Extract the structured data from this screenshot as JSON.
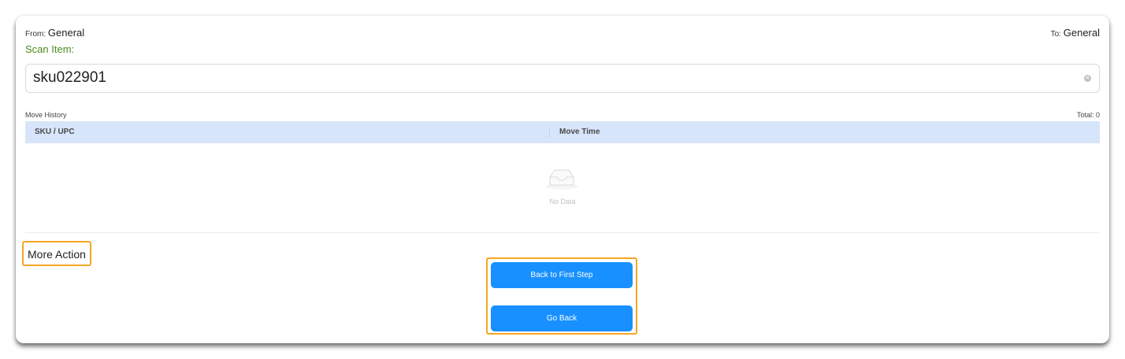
{
  "location": {
    "from_label": "From:",
    "from_value": "General",
    "to_label": "To:",
    "to_value": "General"
  },
  "scan": {
    "label": "Scan Item:",
    "value": "sku022901"
  },
  "history": {
    "title": "Move History",
    "total": "Total: 0",
    "columns": [
      "SKU / UPC",
      "Move Time"
    ],
    "rows": [],
    "empty_text": "No Data"
  },
  "more_action": {
    "label": "More Action"
  },
  "buttons": {
    "back_to_first": "Back to First Step",
    "go_back": "Go Back"
  },
  "colors": {
    "accent": "#1890ff",
    "scan_label": "#4a8a1c",
    "table_header_bg": "#d7e5fb",
    "highlight_border": "#f5a623"
  },
  "icons": {
    "clear": "close-circle-icon",
    "empty": "empty-inbox-icon"
  }
}
